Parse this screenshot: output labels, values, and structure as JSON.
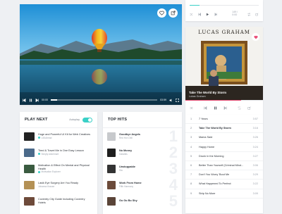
{
  "accent": "#3ad0c7",
  "brand_pink": "#e94e77",
  "video": {
    "current_time": "00:00",
    "duration": "03:59",
    "progress": 0.06,
    "buttons": [
      "heart-icon",
      "external-link-icon"
    ]
  },
  "mini_player": {
    "time": "149 / 0:00",
    "progress": 0.14
  },
  "album": {
    "cover_text": "LUCAS GRAHAM",
    "track_title": "Take The World By Storm",
    "artist": "Lukas Graham",
    "progress": 0.72
  },
  "play_next": {
    "title": "PLAY NEXT",
    "autoplay_label": "Autoplay",
    "autoplay_on": true,
    "items": [
      {
        "title": "Huge and Powerful UI Kit for Web Creatives",
        "meta": "UI8 Ahead",
        "verified": true
      },
      {
        "title": "Tired & Travel Me in One Easy Lesson",
        "meta": "Simply Adventure",
        "verified": true
      },
      {
        "title": "Motivation & Effect On Mental and Physical Health",
        "meta": "Motivation Explorer",
        "verified": true
      },
      {
        "title": "Lasik Eye Surgery Are You Ready",
        "meta": "Johanna Krause",
        "verified": false
      },
      {
        "title": "Coventry City Guide Including Coventry Hotels",
        "meta": "",
        "verified": false
      }
    ]
  },
  "top_hits": {
    "title": "TOP HITS",
    "items": [
      {
        "title": "Goodbye Angels",
        "artist": "Red Hot Chili",
        "rank": "1"
      },
      {
        "title": "No Money",
        "artist": "Galantis",
        "rank": "2"
      },
      {
        "title": "Unstoppable",
        "artist": "Sia",
        "rank": "3"
      },
      {
        "title": "Work From Home",
        "artist": "Fifth Harmony",
        "rank": "4"
      },
      {
        "title": "Go Go Bo Shy",
        "artist": "",
        "rank": "5"
      }
    ]
  },
  "tracklist": [
    {
      "n": "1",
      "title": "7 Years",
      "dur": "3:57"
    },
    {
      "n": "2",
      "title": "Take The World By Storm",
      "dur": "3:16"
    },
    {
      "n": "3",
      "title": "Mama Said",
      "dur": "3:26"
    },
    {
      "n": "4",
      "title": "Happy Home",
      "dur": "3:24"
    },
    {
      "n": "5",
      "title": "Drunk In the Morning",
      "dur": "3:27"
    },
    {
      "n": "6",
      "title": "Better Than Yourself (Criminal Mind...",
      "dur": "3:06"
    },
    {
      "n": "7",
      "title": "Don't You Worry 'Bout Me",
      "dur": "3:29"
    },
    {
      "n": "8",
      "title": "What Happened To Perfect",
      "dur": "3:22"
    },
    {
      "n": "9",
      "title": "Strip No More",
      "dur": "3:09"
    }
  ]
}
